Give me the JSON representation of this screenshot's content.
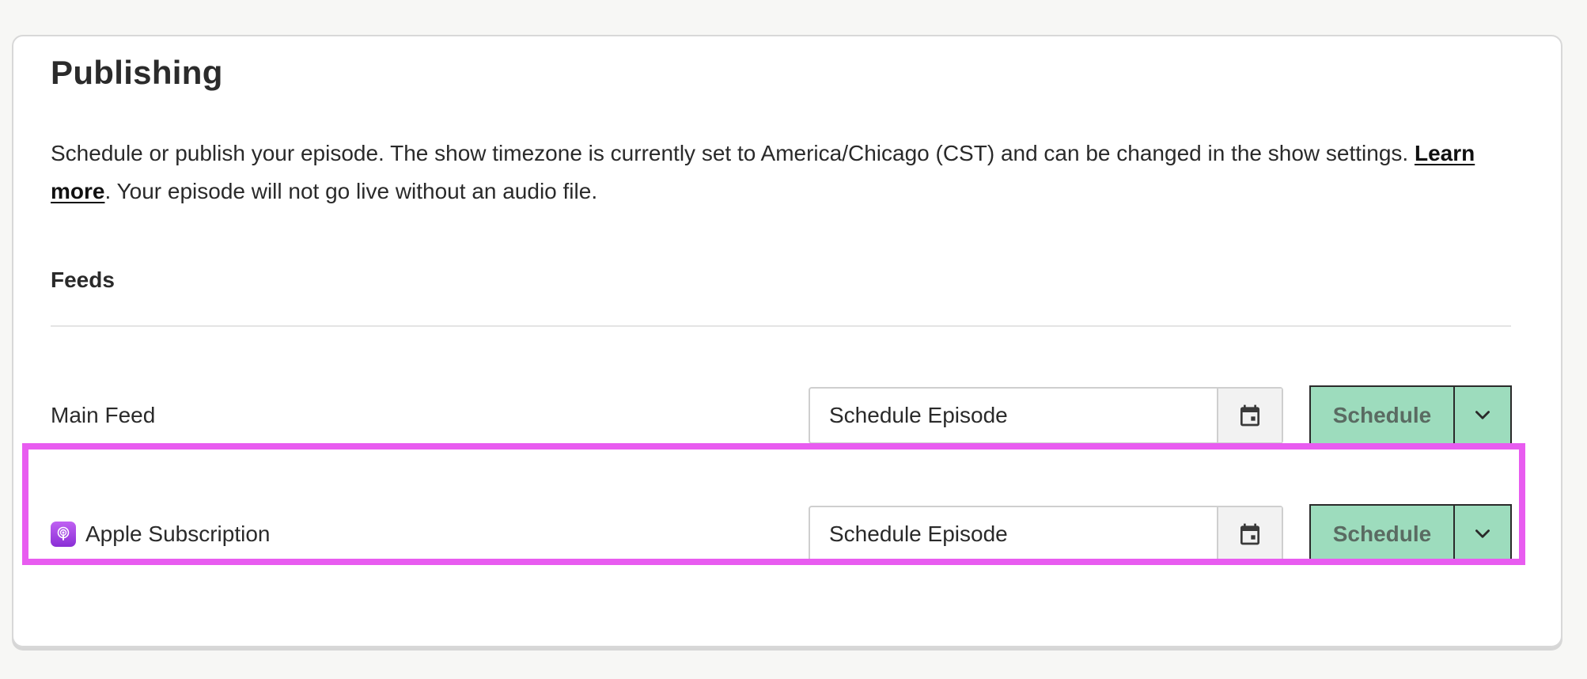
{
  "publishing": {
    "title": "Publishing",
    "description_pre": "Schedule or publish your episode. The show timezone is currently set to America/Chicago (CST) and can be changed in the show settings. ",
    "learn_more": "Learn more",
    "description_post": ". Your episode will not go live without an audio file.",
    "feeds_heading": "Feeds"
  },
  "feeds": [
    {
      "label": "Main Feed",
      "date_placeholder": "Schedule Episode",
      "action_label": "Schedule"
    },
    {
      "label": "Apple Subscription",
      "icon": "apple-podcasts-icon",
      "date_placeholder": "Schedule Episode",
      "action_label": "Schedule"
    }
  ],
  "colors": {
    "accent_green": "#9ddcbd",
    "highlight": "#e85cf0",
    "apple_icon": "#a346e4"
  }
}
